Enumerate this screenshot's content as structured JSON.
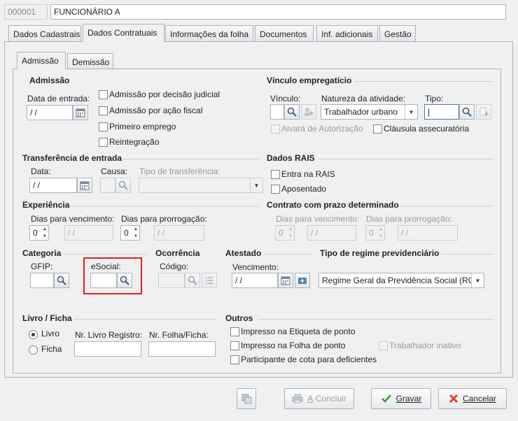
{
  "header": {
    "code": "000001",
    "name": "FUNCIONÁRIO A"
  },
  "tabs": [
    "Dados Cadastrais",
    "Dados Contratuais",
    "Informações da folha",
    "Documentos",
    "Inf. adicionais",
    "Gestão"
  ],
  "subtabs": [
    "Admissão",
    "Demissão"
  ],
  "admissao": {
    "title": "Admissão",
    "data_entrada_label": "Data de entrada:",
    "data_entrada_value": " / /",
    "checks": [
      "Admissão por decisão judicial",
      "Admissão por ação fiscal",
      "Primeiro emprego",
      "Reintegração"
    ]
  },
  "vinculo": {
    "title": "Vínculo empregatício",
    "vinculo_label": "Vínculo:",
    "natureza_label": "Natureza da atividade:",
    "natureza_value": "Trabalhador urbano",
    "tipo_label": "Tipo:",
    "alvara_label": "Alvará de Autorização",
    "clausula_label": "Cláusula assecuratória"
  },
  "transferencia": {
    "title": "Transferência de entrada",
    "data_label": "Data:",
    "data_value": " / /",
    "causa_label": "Causa:",
    "tipo_label": "Tipo de transferência:"
  },
  "rais": {
    "title": "Dados RAIS",
    "entra_label": "Entra na RAIS",
    "aposentado_label": "Aposentado"
  },
  "experiencia": {
    "title": "Experiência",
    "venc_label": "Dias para vencimento:",
    "prorr_label": "Dias para prorrogação:",
    "venc_days": "0",
    "venc_date": " / /",
    "prorr_days": "0",
    "prorr_date": " / /"
  },
  "contrato": {
    "title": "Contrato com prazo determinado",
    "venc_label": "Dias para vencimento:",
    "prorr_label": "Dias para prorrogação:",
    "venc_days": "0",
    "venc_date": " / /",
    "prorr_days": "0",
    "prorr_date": " / /"
  },
  "categoria": {
    "title": "Categoria",
    "gfip_label": "GFIP:",
    "esocial_label": "eSocial:"
  },
  "ocorrencia": {
    "title": "Ocorrência",
    "codigo_label": "Código:"
  },
  "atestado": {
    "title": "Atestado",
    "venc_label": "Vencimento:",
    "venc_value": " / /"
  },
  "regime": {
    "title": "Tipo de regime previdenciário",
    "value": "Regime Geral da Previdência Social (RGP"
  },
  "livro": {
    "title": "Livro / Ficha",
    "livro_label": "Livro",
    "ficha_label": "Ficha",
    "nr_livro_label": "Nr. Livro Registro:",
    "nr_folha_label": "Nr. Folha/Ficha:"
  },
  "outros": {
    "title": "Outros",
    "etiqueta_label": "Impresso na Etiqueta de ponto",
    "folha_label": "Impresso na Folha de ponto",
    "inativo_label": "Trabalhador inativo",
    "cota_label": "Participante de cota para deficientes"
  },
  "buttons": {
    "concluir": "Concluir",
    "gravar": "Gravar",
    "cancelar": "Cancelar"
  },
  "colors": {
    "highlight": "#e02020",
    "accent_green": "#3a9a2e",
    "cancel_red": "#d9432f"
  }
}
